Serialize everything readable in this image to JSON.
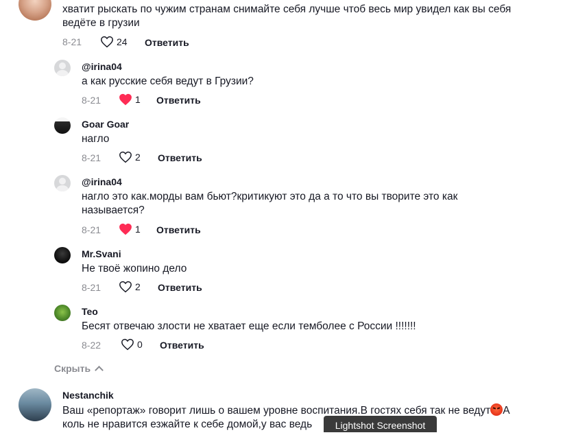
{
  "top_comment": {
    "text": "хватит рыскать по чужим странам снимайте себя лучше чтоб весь мир увидел как вы себя ведёте в грузии",
    "date": "8-21",
    "likes": "24",
    "reply_label": "Ответить",
    "liked": false
  },
  "replies": [
    {
      "username": "@irina04",
      "text": "а как русские себя ведут в Грузии?",
      "date": "8-21",
      "likes": "1",
      "reply_label": "Ответить",
      "liked": true
    },
    {
      "username": "Goar Goar",
      "text": "нагло",
      "date": "8-21",
      "likes": "2",
      "reply_label": "Ответить",
      "liked": false
    },
    {
      "username": "@irina04",
      "text": "нагло это как.морды вам бьют?критикуют это да а то что вы творите это как называется?",
      "date": "8-21",
      "likes": "1",
      "reply_label": "Ответить",
      "liked": true
    },
    {
      "username": "Mr.Svani",
      "text": "Не твоё жопино дело",
      "date": "8-21",
      "likes": "2",
      "reply_label": "Ответить",
      "liked": false
    },
    {
      "username": "Teo",
      "text": "Бесят отвечаю злости не хватает еще если темболее с России !!!!!!!",
      "date": "8-22",
      "likes": "0",
      "reply_label": "Ответить",
      "liked": false
    }
  ],
  "hide_label": "Скрыть",
  "next_comment": {
    "username": "Nestanchik",
    "text_part1": "Ваш «репортаж» говорит лишь о вашем уровне воспитания.В гостях себя так не ведут",
    "text_part2": "А",
    "text_line2": "коль не нравится езжайте к себе домой,у вас ведь"
  },
  "tooltip": "Lightshot Screenshot",
  "colors": {
    "heart_liked": "#fe2c55",
    "muted": "#8a8b91",
    "text": "#161823"
  }
}
